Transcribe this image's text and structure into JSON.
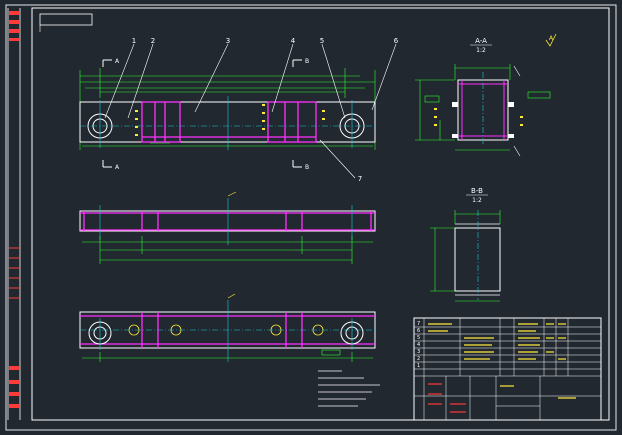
{
  "drawing": {
    "title_box_text": "",
    "section_aa": {
      "title": "A-A",
      "scale": "1:2"
    },
    "section_bb": {
      "title": "B-B",
      "scale": "1:2"
    },
    "balloons": [
      "1",
      "2",
      "3",
      "4",
      "5",
      "6",
      "7"
    ],
    "cut_marks": [
      "A",
      "A",
      "B",
      "B"
    ],
    "roughness": "A"
  },
  "title_block": {
    "rows": [
      "7",
      "6",
      "5",
      "4",
      "3",
      "2",
      "1"
    ]
  },
  "colors": {
    "background": "#212830",
    "border": "#f2f2f2",
    "part_outline": "#ffffff",
    "section_fill": "#ff30ff",
    "dimension": "#2dff2d",
    "centerline": "#17c8d6",
    "annotation_red": "#ff3a3a",
    "hole_yellow": "#ffe93a"
  }
}
